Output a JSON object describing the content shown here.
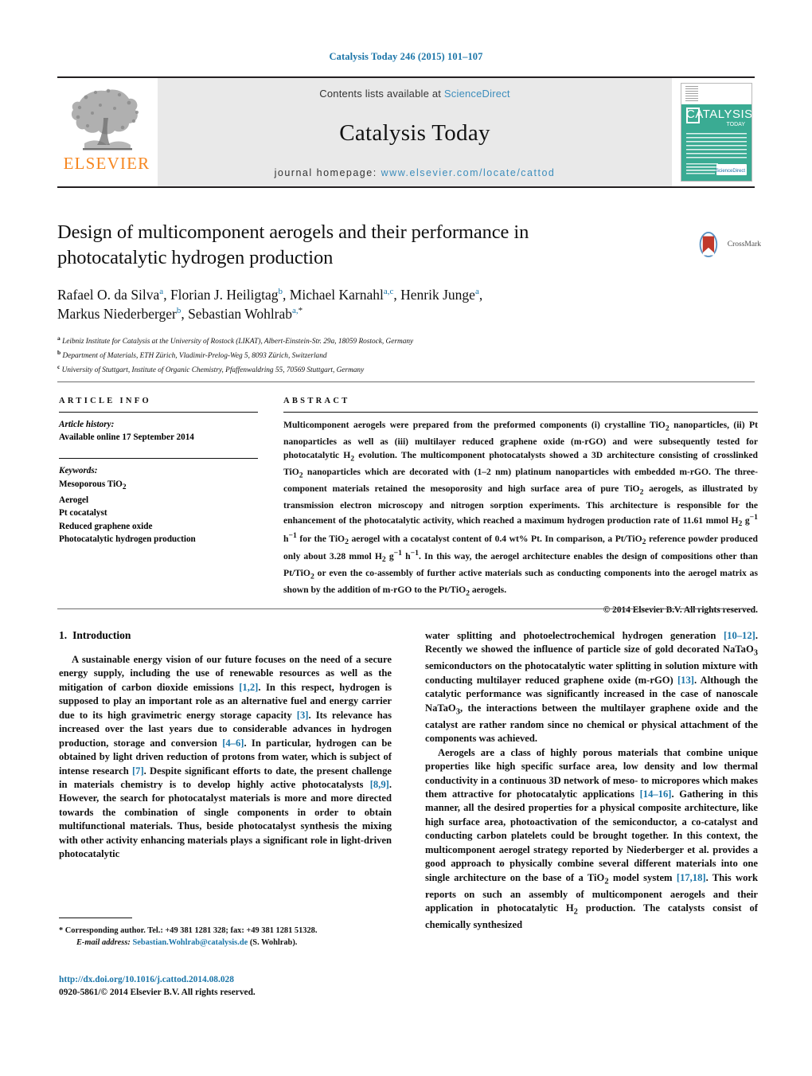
{
  "running_head": "Catalysis Today 246 (2015) 101–107",
  "masthead": {
    "publisher": "ELSEVIER",
    "contents_prefix": "Contents lists available at ",
    "contents_link": "ScienceDirect",
    "journal_name": "Catalysis Today",
    "homepage_prefix": "journal homepage: ",
    "homepage_url": "www.elsevier.com/locate/cattod",
    "cover": {
      "title": "CATALYSIS",
      "subtitle": "TODAY",
      "badge": "ScienceDirect"
    },
    "colors": {
      "link": "#3c8dbc",
      "elsevier_orange": "#f6861f",
      "cover_green": "#3aab93",
      "panel_gray": "#e9e9e9"
    }
  },
  "crossmark": {
    "label": "CrossMark"
  },
  "article": {
    "title_line1": "Design of multicomponent aerogels and their performance in",
    "title_line2": "photocatalytic hydrogen production",
    "authors": [
      {
        "name": "Rafael O. da Silva",
        "sup": "a",
        "sep": ", "
      },
      {
        "name": "Florian J. Heiligtag",
        "sup": "b",
        "sep": ", "
      },
      {
        "name": "Michael Karnahl",
        "sup": "a,c",
        "sep": ", "
      },
      {
        "name": "Henrik Junge",
        "sup": "a",
        "sep": ","
      },
      {
        "name": "Markus Niederberger",
        "sup": "b",
        "sep": ", "
      },
      {
        "name": "Sebastian Wohlrab",
        "sup": "a,",
        "sup_star": "*",
        "sep": ""
      }
    ],
    "affiliations": [
      {
        "mark": "a",
        "text": "Leibniz Institute for Catalysis at the University of Rostock (LIKAT), Albert-Einstein-Str. 29a, 18059 Rostock, Germany"
      },
      {
        "mark": "b",
        "text": "Department of Materials, ETH Zürich, Vladimir-Prelog-Weg 5, 8093 Zürich, Switzerland"
      },
      {
        "mark": "c",
        "text": "University of Stuttgart, Institute of Organic Chemistry, Pfaffenwaldring 55, 70569 Stuttgart, Germany"
      }
    ]
  },
  "article_info": {
    "heading": "ARTICLE INFO",
    "history_label": "Article history:",
    "history_value": "Available online 17 September 2014",
    "keywords_label": "Keywords:",
    "keywords": [
      "Mesoporous TiO2",
      "Aerogel",
      "Pt cocatalyst",
      "Reduced graphene oxide",
      "Photocatalytic hydrogen production"
    ]
  },
  "abstract": {
    "heading": "ABSTRACT",
    "body": "Multicomponent aerogels were prepared from the preformed components (i) crystalline TiO2 nanoparticles, (ii) Pt nanoparticles as well as (iii) multilayer reduced graphene oxide (m-rGO) and were subsequently tested for photocatalytic H2 evolution. The multicomponent photocatalysts showed a 3D architecture consisting of crosslinked TiO2 nanoparticles which are decorated with (1–2 nm) platinum nanoparticles with embedded m-rGO. The three-component materials retained the mesoporosity and high surface area of pure TiO2 aerogels, as illustrated by transmission electron microscopy and nitrogen sorption experiments. This architecture is responsible for the enhancement of the photocatalytic activity, which reached a maximum hydrogen production rate of 11.61 mmol H2 g−1 h−1 for the TiO2 aerogel with a cocatalyst content of 0.4 wt% Pt. In comparison, a Pt/TiO2 reference powder produced only about 3.28 mmol H2 g−1 h−1. In this way, the aerogel architecture enables the design of compositions other than Pt/TiO2 or even the co-assembly of further active materials such as conducting components into the aerogel matrix as shown by the addition of m-rGO to the Pt/TiO2 aerogels.",
    "copyright": "© 2014 Elsevier B.V. All rights reserved."
  },
  "introduction": {
    "number": "1.",
    "heading": "Introduction",
    "left_paragraph": "A sustainable energy vision of our future focuses on the need of a secure energy supply, including the use of renewable resources as well as the mitigation of carbon dioxide emissions [1,2]. In this respect, hydrogen is supposed to play an important role as an alternative fuel and energy carrier due to its high gravimetric energy storage capacity [3]. Its relevance has increased over the last years due to considerable advances in hydrogen production, storage and conversion [4–6]. In particular, hydrogen can be obtained by light driven reduction of protons from water, which is subject of intense research [7]. Despite significant efforts to date, the present challenge in materials chemistry is to develop highly active photocatalysts [8,9]. However, the search for photocatalyst materials is more and more directed towards the combination of single components in order to obtain multifunctional materials. Thus, beside photocatalyst synthesis the mixing with other activity enhancing materials plays a significant role in light-driven photocatalytic",
    "right_paragraph_1": "water splitting and photoelectrochemical hydrogen generation [10–12]. Recently we showed the influence of particle size of gold decorated NaTaO3 semiconductors on the photocatalytic water splitting in solution mixture with conducting multilayer reduced graphene oxide (m-rGO) [13]. Although the catalytic performance was significantly increased in the case of nanoscale NaTaO3, the interactions between the multilayer graphene oxide and the catalyst are rather random since no chemical or physical attachment of the components was achieved.",
    "right_paragraph_2": "Aerogels are a class of highly porous materials that combine unique properties like high specific surface area, low density and low thermal conductivity in a continuous 3D network of meso- to micropores which makes them attractive for photocatalytic applications [14–16]. Gathering in this manner, all the desired properties for a physical composite architecture, like high surface area, photoactivation of the semiconductor, a co-catalyst and conducting carbon platelets could be brought together. In this context, the multicomponent aerogel strategy reported by Niederberger et al. provides a good approach to physically combine several different materials into one single architecture on the base of a TiO2 model system [17,18]. This work reports on such an assembly of multicomponent aerogels and their application in photocatalytic H2 production. The catalysts consist of chemically synthesized"
  },
  "footnotes": {
    "corresponding": "* Corresponding author. Tel.: +49 381 1281 328; fax: +49 381 1281 51328.",
    "email_label": "E-mail address:",
    "email": "Sebastian.Wohlrab@catalysis.de",
    "email_suffix": "(S. Wohlrab).",
    "doi": "http://dx.doi.org/10.1016/j.cattod.2014.08.028",
    "issn": "0920-5861/© 2014 Elsevier B.V. All rights reserved."
  }
}
